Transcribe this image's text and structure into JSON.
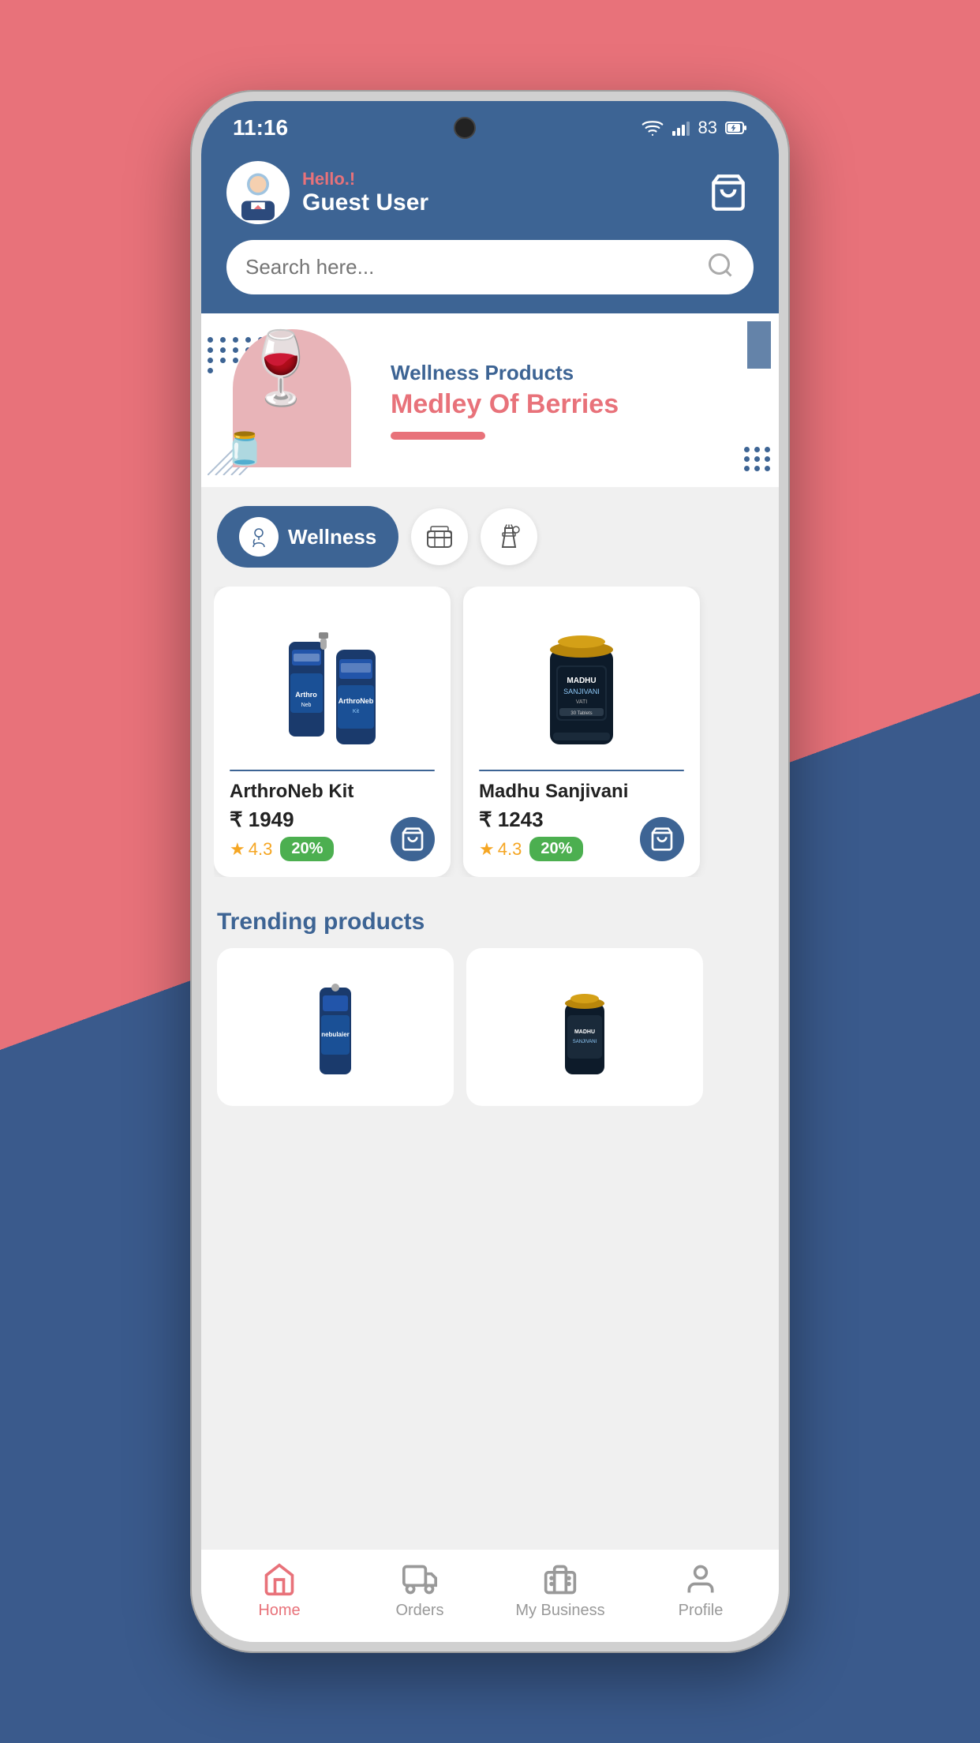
{
  "status_bar": {
    "time": "11:16",
    "battery": "83"
  },
  "header": {
    "greeting": "Hello.!",
    "username": "Guest User",
    "cart_label": "cart"
  },
  "search": {
    "placeholder": "Search here..."
  },
  "banner": {
    "subtitle": "Wellness Products",
    "title": "Medley Of Berries"
  },
  "categories": [
    {
      "id": "wellness",
      "label": "Wellness",
      "active": true
    },
    {
      "id": "food",
      "label": "Food",
      "active": false
    },
    {
      "id": "cleaning",
      "label": "Cleaning",
      "active": false
    }
  ],
  "products": [
    {
      "id": "arthroneb",
      "name": "ArthroNeb Kit",
      "price": "₹ 1949",
      "rating": "4.3",
      "discount": "20%"
    },
    {
      "id": "madhu",
      "name": "Madhu Sanjivani",
      "price": "₹ 1243",
      "rating": "4.3",
      "discount": "20%"
    }
  ],
  "trending": {
    "title": "Trending products"
  },
  "bottom_nav": [
    {
      "id": "home",
      "label": "Home",
      "active": true
    },
    {
      "id": "orders",
      "label": "Orders",
      "active": false
    },
    {
      "id": "business",
      "label": "My Business",
      "active": false
    },
    {
      "id": "profile",
      "label": "Profile",
      "active": false
    }
  ]
}
